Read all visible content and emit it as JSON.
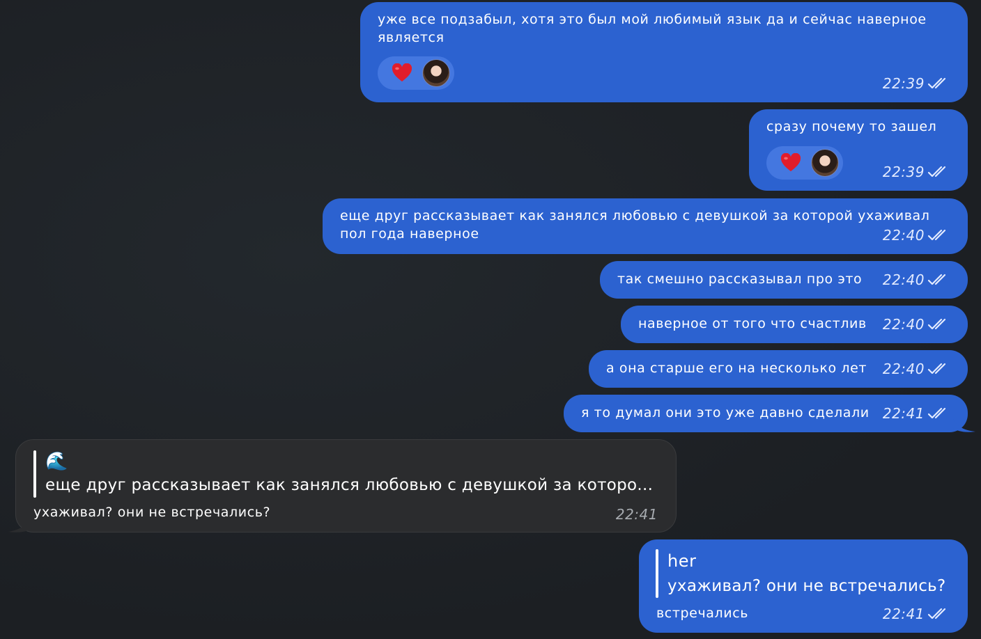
{
  "colors": {
    "background": "#1d2125",
    "outgoing_bubble": "#2c62d0",
    "incoming_bubble": "#2b2c2e",
    "reaction_pill": "#4477e0"
  },
  "messages": [
    {
      "text_line1": "уже все подзабыл, хотя это был мой любимый язык да и сейчас наверное",
      "text_line2": "является",
      "time": "22:39",
      "reaction": "heart-emoji"
    },
    {
      "text": "сразу почему то зашел",
      "time": "22:39",
      "reaction": "heart-emoji"
    },
    {
      "text_line1": "еще друг рассказывает как занялся любовью с девушкой за которой ухаживал",
      "text_line2": "пол года наверное",
      "time": "22:40"
    },
    {
      "text": "так смешно рассказывал про это",
      "time": "22:40"
    },
    {
      "text": "наверное от того что счастлив",
      "time": "22:40"
    },
    {
      "text": "а она старше его на несколько лет",
      "time": "22:40"
    },
    {
      "text": "я то думал они это уже давно сделали",
      "time": "22:41"
    },
    {
      "incoming": true,
      "quote_emoji": "🌊",
      "quote_text": "еще друг рассказывает как занялся любовью с девушкой за которо...",
      "text": "ухаживал? они не встречались?",
      "time": "22:41"
    },
    {
      "quote_author": "her",
      "quote_text": "ухаживал? они не встречались?",
      "text": "встречались",
      "time": "22:41"
    }
  ]
}
